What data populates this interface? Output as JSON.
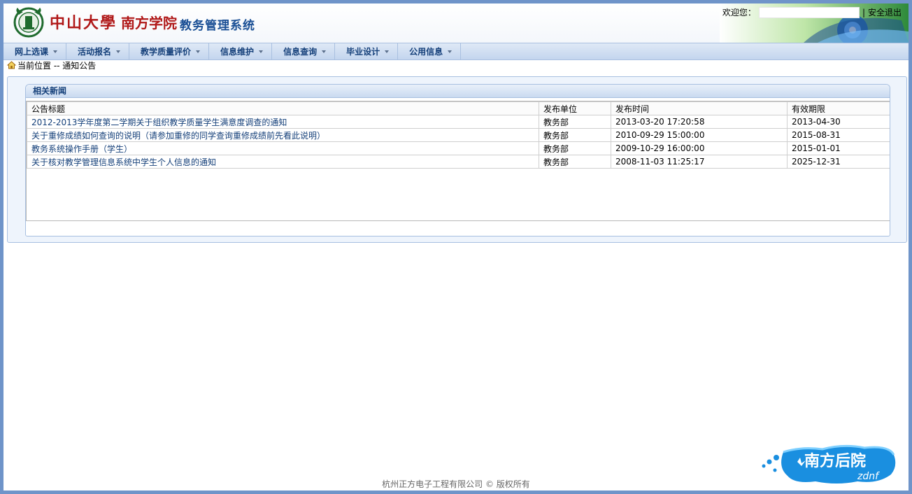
{
  "header": {
    "logo_cn": "中山大學",
    "school": "南方学院",
    "system": "教务管理系统",
    "welcome_label": "欢迎您：",
    "logout_label": "安全退出",
    "separator": "|"
  },
  "menu": {
    "items": [
      {
        "label": "网上选课"
      },
      {
        "label": "活动报名"
      },
      {
        "label": "教学质量评价"
      },
      {
        "label": "信息维护"
      },
      {
        "label": "信息查询"
      },
      {
        "label": "毕业设计"
      },
      {
        "label": "公用信息"
      }
    ]
  },
  "breadcrumb": {
    "text": "当前位置 -- 通知公告"
  },
  "panel": {
    "title": "相关新闻",
    "columns": [
      "公告标题",
      "发布单位",
      "发布时间",
      "有效期限"
    ],
    "rows": [
      [
        "2012-2013学年度第二学期关于组织教学质量学生满意度调查的通知",
        "教务部",
        "2013-03-20 17:20:58",
        "2013-04-30"
      ],
      [
        "关于重修成绩如何查询的说明（请参加重修的同学查询重修成绩前先看此说明）",
        "教务部",
        "2010-09-29 15:00:00",
        "2015-08-31"
      ],
      [
        "教务系统操作手册（学生）",
        "教务部",
        "2009-10-29 16:00:00",
        "2015-01-01"
      ],
      [
        "关于核对教学管理信息系统中学生个人信息的通知",
        "教务部",
        "2008-11-03 11:25:17",
        "2025-12-31"
      ]
    ]
  },
  "footer": {
    "text": "杭州正方电子工程有限公司 © 版权所有"
  },
  "corner_logo": {
    "text": "南方后院",
    "sub": "zdnf"
  },
  "colors": {
    "frame": "#6f94c9",
    "menu_text": "#15407a",
    "logo_red": "#b01818",
    "system_blue": "#1a4f95"
  }
}
